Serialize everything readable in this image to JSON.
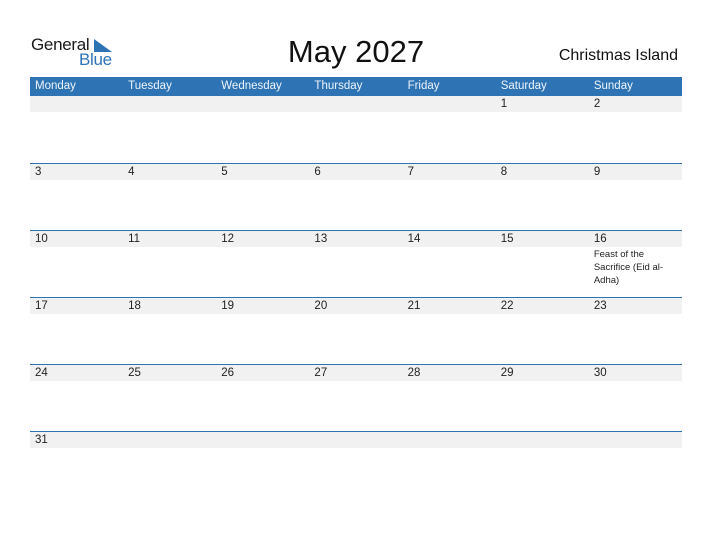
{
  "logo": {
    "word1": "General",
    "word2": "Blue",
    "icon": "flag-triangle-icon"
  },
  "title": "May 2027",
  "region": "Christmas Island",
  "colors": {
    "accent": "#2e74b5",
    "band": "#f1f1f1"
  },
  "weekdays": [
    "Monday",
    "Tuesday",
    "Wednesday",
    "Thursday",
    "Friday",
    "Saturday",
    "Sunday"
  ],
  "weeks": [
    {
      "days": [
        {
          "num": "",
          "event": ""
        },
        {
          "num": "",
          "event": ""
        },
        {
          "num": "",
          "event": ""
        },
        {
          "num": "",
          "event": ""
        },
        {
          "num": "",
          "event": ""
        },
        {
          "num": "1",
          "event": ""
        },
        {
          "num": "2",
          "event": ""
        }
      ]
    },
    {
      "days": [
        {
          "num": "3",
          "event": ""
        },
        {
          "num": "4",
          "event": ""
        },
        {
          "num": "5",
          "event": ""
        },
        {
          "num": "6",
          "event": ""
        },
        {
          "num": "7",
          "event": ""
        },
        {
          "num": "8",
          "event": ""
        },
        {
          "num": "9",
          "event": ""
        }
      ]
    },
    {
      "days": [
        {
          "num": "10",
          "event": ""
        },
        {
          "num": "11",
          "event": ""
        },
        {
          "num": "12",
          "event": ""
        },
        {
          "num": "13",
          "event": ""
        },
        {
          "num": "14",
          "event": ""
        },
        {
          "num": "15",
          "event": ""
        },
        {
          "num": "16",
          "event": "Feast of the Sacrifice (Eid al-Adha)"
        }
      ]
    },
    {
      "days": [
        {
          "num": "17",
          "event": ""
        },
        {
          "num": "18",
          "event": ""
        },
        {
          "num": "19",
          "event": ""
        },
        {
          "num": "20",
          "event": ""
        },
        {
          "num": "21",
          "event": ""
        },
        {
          "num": "22",
          "event": ""
        },
        {
          "num": "23",
          "event": ""
        }
      ]
    },
    {
      "days": [
        {
          "num": "24",
          "event": ""
        },
        {
          "num": "25",
          "event": ""
        },
        {
          "num": "26",
          "event": ""
        },
        {
          "num": "27",
          "event": ""
        },
        {
          "num": "28",
          "event": ""
        },
        {
          "num": "29",
          "event": ""
        },
        {
          "num": "30",
          "event": ""
        }
      ]
    },
    {
      "days": [
        {
          "num": "31",
          "event": ""
        },
        {
          "num": "",
          "event": ""
        },
        {
          "num": "",
          "event": ""
        },
        {
          "num": "",
          "event": ""
        },
        {
          "num": "",
          "event": ""
        },
        {
          "num": "",
          "event": ""
        },
        {
          "num": "",
          "event": ""
        }
      ]
    }
  ]
}
